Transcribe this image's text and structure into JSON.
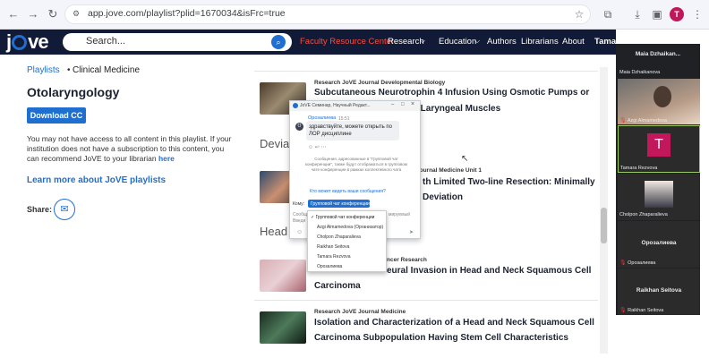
{
  "browser": {
    "url": "app.jove.com/playlist?plid=1670034&isFrc=true",
    "profile_initial": "T"
  },
  "header": {
    "logo": "jove",
    "search_placeholder": "Search...",
    "nav": [
      "Faculty Resource Center",
      "Research",
      "Education",
      "Authors",
      "Librarians",
      "About",
      "Tamar"
    ]
  },
  "sidebar": {
    "crumb_root": "Playlists",
    "crumb_sep": "•",
    "crumb_current": "Clinical Medicine",
    "title": "Otolaryngology",
    "download_label": "Download CC",
    "notice": "You may not have access to all content in this playlist. If your institution does not have a subscription to this content, you can recommend JoVE to your librarian ",
    "notice_link": "here",
    "learn_more": "Learn more about JoVE playlists",
    "share_label": "Share:"
  },
  "items": [
    {
      "tags": "Research   JoVE Journal   Developmental Biology",
      "title1": "Subcutaneous Neurotrophin 4 Infusion Using Osmotic Pumps or",
      "title2": "Enhances Aging Rat Laryngeal Muscles"
    },
    {
      "tags": "Journal   Medicine   Unit 1",
      "title1": "th Limited Two-line Resection: Minimally",
      "title2": "Deviation"
    },
    {
      "tags": "ncer Research",
      "title1": "eural Invasion in Head and Neck Squamous Cell",
      "title2": "Carcinoma"
    },
    {
      "tags": "Research   JoVE Journal   Medicine",
      "title1": "Isolation and Characterization of a Head and Neck Squamous Cell",
      "title2": "Carcinoma Subpopulation Having Stem Cell Characteristics"
    }
  ],
  "sections": [
    "Devia",
    "Head"
  ],
  "chat": {
    "window_title": "JoVE Семинар, Научный Редакт...",
    "sender": "Орозалиева",
    "time": "15:51",
    "avatar_letter": "О",
    "message": "здравствуйте, можете открыть по ЛОР дисциплине",
    "info": "Сообщения, адресованные в \"Групповой чат конференции\", также будут отображаться в групповом чате конференции в рамках коллективного чата",
    "who_can_see": "Кто может видеть ваши сообщения?",
    "to_label": "Кому:",
    "to_value": "Групповой чат конференции",
    "compose_partial1": "Сообщ",
    "compose_partial2": "Введи",
    "compose_hint": "мируемый"
  },
  "dropdown": {
    "options": [
      "Групповой чат конференции",
      "Azgi Almamedova (Организатор)",
      "Cholpon Zhaparalieva",
      "Raikhan Seitova",
      "Tamara Rezvova",
      "Орозалиева"
    ]
  },
  "participants": {
    "top_name": "Maia Dzhaikan...",
    "tiles": [
      {
        "label": "Maia Dzhaikanova",
        "kind": "name-top"
      },
      {
        "label": "Azgi Almamedova",
        "kind": "video-face"
      },
      {
        "label": "Tamara Rezvova",
        "kind": "avatar",
        "letter": "T",
        "color": "#c2185b"
      },
      {
        "label": "Cholpon Zhaparalieva",
        "kind": "video-person"
      },
      {
        "label": "Орозалиева",
        "kind": "name-center",
        "center": "Орозалиева"
      },
      {
        "label": "Raikhan Seitova",
        "kind": "name-center",
        "center": "Raikhan Seitova"
      }
    ]
  },
  "colors": {
    "jove_navy": "#111a36",
    "jove_blue": "#1f6fd0",
    "accent_red": "#ff4b3a"
  }
}
